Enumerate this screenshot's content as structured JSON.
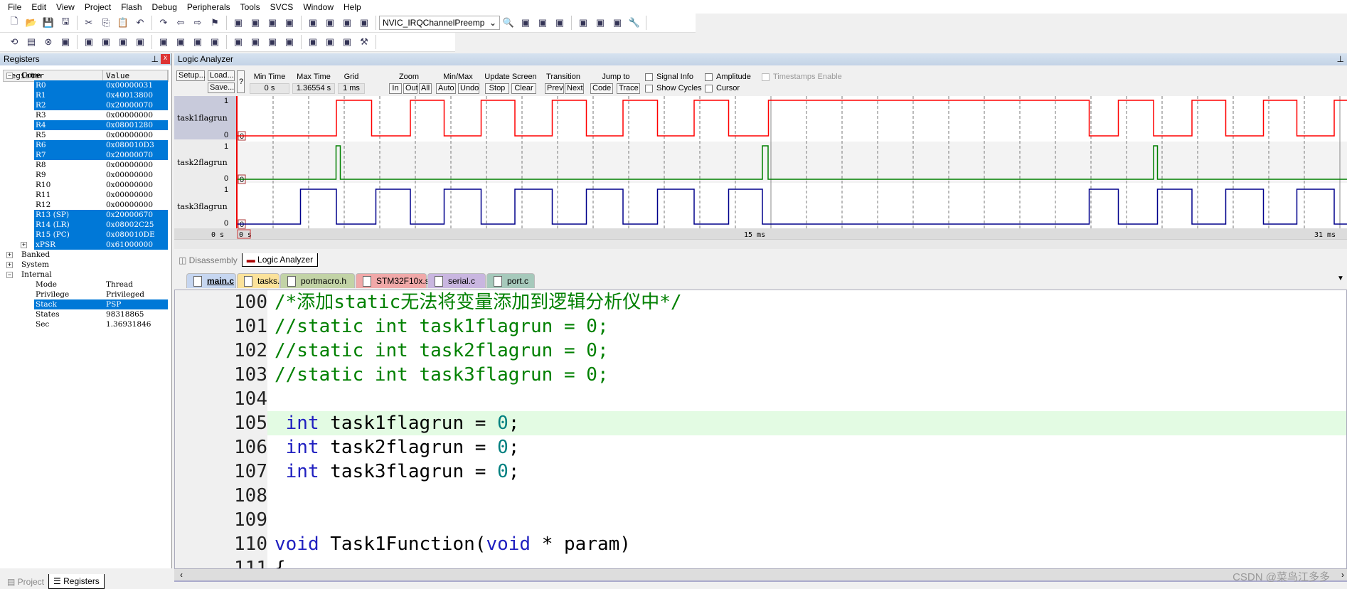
{
  "menu": [
    "File",
    "Edit",
    "View",
    "Project",
    "Flash",
    "Debug",
    "Peripherals",
    "Tools",
    "SVCS",
    "Window",
    "Help"
  ],
  "toolbar1": {
    "icons": [
      "new-file",
      "open-file",
      "save",
      "save-all",
      "cut",
      "copy",
      "paste",
      "undo",
      "redo",
      "nav-back",
      "nav-forward",
      "bookmark",
      "prev-bookmark",
      "next-bookmark",
      "clear-bookmarks",
      "indent",
      "unindent",
      "comment",
      "uncomment",
      "find-in-files"
    ],
    "combo": "NVIC_IRQChannelPreemp",
    "icons2": [
      "find",
      "debug-session",
      "breakpoint-insert",
      "breakpoint-enable",
      "breakpoint-disable",
      "breakpoint-kill",
      "window-layout",
      "configure"
    ]
  },
  "toolbar2": {
    "icons": [
      "reset",
      "run",
      "stop",
      "step-into",
      "step-over",
      "step-out",
      "run-to-cursor",
      "show-next-statement",
      "command-window",
      "disassembly-window",
      "symbols-window",
      "registers-window",
      "call-stack-window",
      "watch-window",
      "memory-window",
      "serial-window",
      "analysis-window",
      "trace-window",
      "system-viewer",
      "toolbox"
    ]
  },
  "registers": {
    "title": "Registers",
    "col_register": "Register",
    "col_value": "Value",
    "groups": [
      {
        "name": "Core",
        "expanded": true
      },
      {
        "name": "Banked",
        "expanded": false
      },
      {
        "name": "System",
        "expanded": false
      },
      {
        "name": "Internal",
        "expanded": true
      }
    ],
    "core": [
      [
        "R0",
        "0x00000031",
        true
      ],
      [
        "R1",
        "0x40013800",
        true
      ],
      [
        "R2",
        "0x20000070",
        true
      ],
      [
        "R3",
        "0x00000000",
        false
      ],
      [
        "R4",
        "0x08001280",
        true
      ],
      [
        "R5",
        "0x00000000",
        false
      ],
      [
        "R6",
        "0x080010D3",
        true
      ],
      [
        "R7",
        "0x20000070",
        true
      ],
      [
        "R8",
        "0x00000000",
        false
      ],
      [
        "R9",
        "0x00000000",
        false
      ],
      [
        "R10",
        "0x00000000",
        false
      ],
      [
        "R11",
        "0x00000000",
        false
      ],
      [
        "R12",
        "0x00000000",
        false
      ],
      [
        "R13 (SP)",
        "0x20000670",
        true
      ],
      [
        "R14 (LR)",
        "0x08002C25",
        true
      ],
      [
        "R15 (PC)",
        "0x080010DE",
        true
      ],
      [
        "xPSR",
        "0x61000000",
        true
      ]
    ],
    "internal": [
      [
        "Mode",
        "Thread",
        false
      ],
      [
        "Privilege",
        "Privileged",
        false
      ],
      [
        "Stack",
        "PSP",
        true
      ],
      [
        "States",
        "98318865",
        false
      ],
      [
        "Sec",
        "1.36931846",
        false
      ]
    ]
  },
  "bottom_tabs": [
    "Project",
    "Registers"
  ],
  "logic_analyzer": {
    "title": "Logic Analyzer",
    "setup": "Setup...",
    "load": "Load...",
    "save": "Save...",
    "help": "?",
    "min_time_label": "Min Time",
    "min_time": "0 s",
    "max_time_label": "Max Time",
    "max_time": "1.36554 s",
    "grid_label": "Grid",
    "grid": "1 ms",
    "zoom_label": "Zoom",
    "zoom_in": "In",
    "zoom_out": "Out",
    "zoom_all": "All",
    "minmax_label": "Min/Max",
    "auto": "Auto",
    "undo": "Undo",
    "update_label": "Update Screen",
    "stop": "Stop",
    "clear": "Clear",
    "transition_label": "Transition",
    "prev": "Prev",
    "next": "Next",
    "jump_label": "Jump to",
    "code": "Code",
    "trace": "Trace",
    "checkboxes": {
      "signal_info": "Signal Info",
      "amplitude": "Amplitude",
      "timestamps": "Timestamps Enable",
      "show_cycles": "Show Cycles",
      "cursor": "Cursor"
    },
    "axis_start": "0 s",
    "cursor_label": "0 s",
    "tick_15": "15 ms",
    "tick_31": "31 ms",
    "ms_range": [
      0,
      31.2
    ],
    "signals": [
      {
        "name": "task1flagrun",
        "color": "#ff0000",
        "hi": "1",
        "lo": "0",
        "value": "0",
        "edges": [
          2.78,
          3.77,
          4.86,
          5.81,
          6.85,
          7.8,
          8.85,
          9.81,
          10.84,
          11.81,
          12.84,
          13.81,
          14.93,
          23.95,
          24.77,
          25.76,
          26.84,
          27.79,
          28.85,
          29.79,
          30.84
        ]
      },
      {
        "name": "task2flagrun",
        "color": "#008000",
        "hi": "1",
        "lo": "0",
        "value": "0",
        "edges": [
          2.77,
          2.89,
          14.76,
          14.92,
          25.76,
          25.87
        ]
      },
      {
        "name": "task3flagrun",
        "color": "#00008b",
        "hi": "1",
        "lo": "0",
        "value": "0",
        "edges": [
          1.77,
          2.78,
          3.89,
          4.86,
          5.81,
          6.85,
          7.8,
          8.85,
          9.81,
          10.84,
          11.81,
          12.84,
          13.81,
          14.76,
          23.95,
          24.77,
          25.87,
          26.84,
          27.79,
          28.85,
          29.79,
          30.84
        ]
      }
    ]
  },
  "view_tabs": [
    "Disassembly",
    "Logic Analyzer"
  ],
  "file_tabs": [
    {
      "name": "main.c",
      "color": "#c6d6f0"
    },
    {
      "name": "tasks.c",
      "color": "#fbe29a"
    },
    {
      "name": "portmacro.h",
      "color": "#c2d3a6"
    },
    {
      "name": "STM32F10x.s",
      "color": "#f0a8a8"
    },
    {
      "name": "serial.c",
      "color": "#c9b6e0"
    },
    {
      "name": "port.c",
      "color": "#a6c9bb"
    }
  ],
  "code": [
    {
      "n": "100",
      "t": "/*添加static无法将变量添加到逻辑分析仪中*/"
    },
    {
      "n": "101",
      "t": "//static int task1flagrun = 0;"
    },
    {
      "n": "102",
      "t": "//static int task2flagrun = 0;"
    },
    {
      "n": "103",
      "t": "//static int task3flagrun = 0;"
    },
    {
      "n": "104",
      "t": ""
    },
    {
      "n": "105",
      "t": " int task1flagrun = 0;"
    },
    {
      "n": "106",
      "t": " int task2flagrun = 0;"
    },
    {
      "n": "107",
      "t": " int task3flagrun = 0;"
    },
    {
      "n": "108",
      "t": ""
    },
    {
      "n": "109",
      "t": ""
    },
    {
      "n": "110",
      "t": "void Task1Function(void * param)"
    },
    {
      "n": "111",
      "t": "{"
    }
  ],
  "watermark": "CSDN @菜鸟江多多"
}
